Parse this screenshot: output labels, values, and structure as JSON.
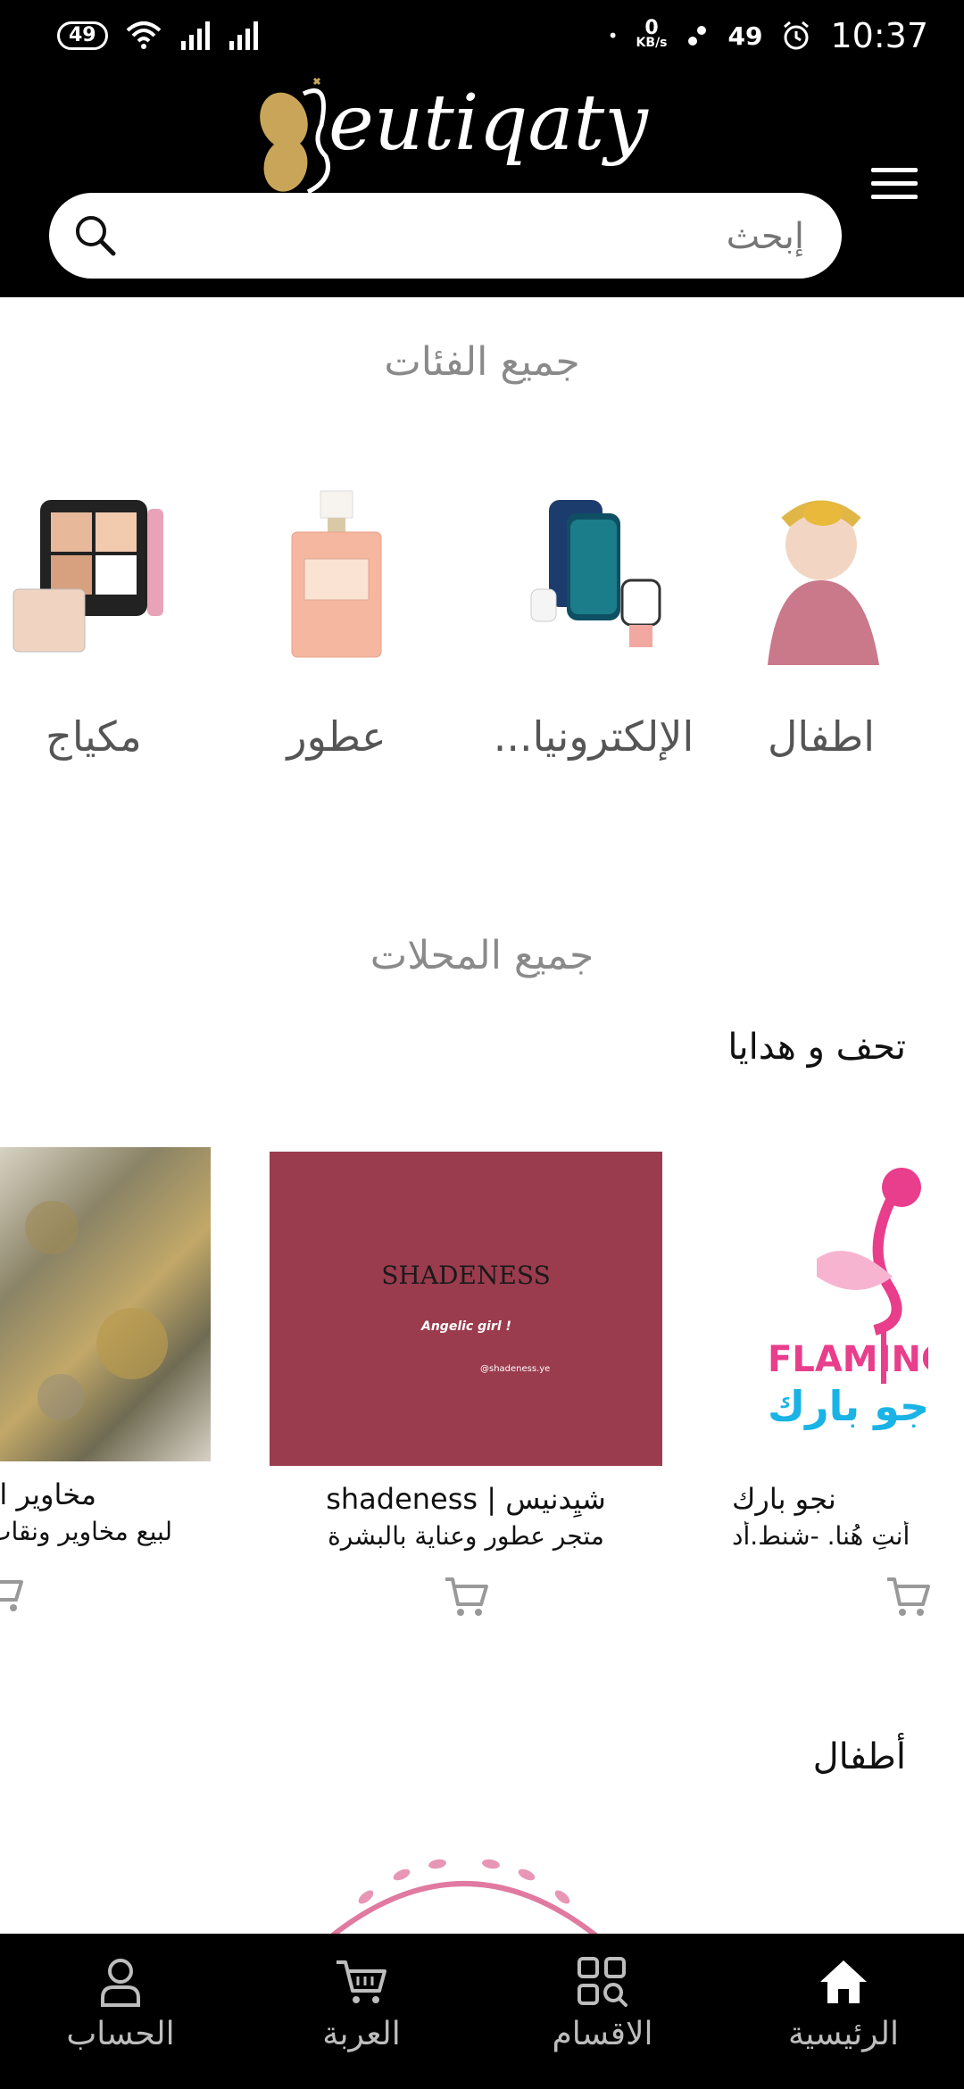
{
  "status_bar": {
    "battery_left": "49",
    "net_speed_value": "0",
    "net_speed_unit": "KB/s",
    "battery_right": "49",
    "time": "10:37"
  },
  "header": {
    "logo_text": "eutiqaty",
    "search_placeholder": "إبحث"
  },
  "categories": {
    "title": "جميع الفئات",
    "items": [
      {
        "label": "اطفال",
        "icon": "kid-photo"
      },
      {
        "label": "الإلكترونيا...",
        "icon": "electronics-photo"
      },
      {
        "label": "عطور",
        "icon": "perfume-photo"
      },
      {
        "label": "مكياج",
        "icon": "makeup-photo"
      }
    ]
  },
  "stores": {
    "title": "جميع المحلات",
    "groups": [
      {
        "title": "تحف و هدايا",
        "items": [
          {
            "name": "نجو بارك",
            "desc": "أنتِ هُنا. -شنط.أد",
            "image_text_1": "FLAMINGO",
            "image_text_2": "جو بارك"
          },
          {
            "name": "شيِدنيس | shadeness",
            "desc": "متجر عطور وعناية بالبشرة",
            "image_text_1": "SHADENESS",
            "image_text_2": "Angelic girl !",
            "image_text_3": "@shadeness.ye"
          },
          {
            "name": "مخاوير ا",
            "desc": "لبيع مخاوير ونقاب"
          }
        ]
      },
      {
        "title": "أطفال"
      }
    ]
  },
  "bottom_nav": {
    "items": [
      {
        "label": "الرئيسية",
        "icon": "home-icon"
      },
      {
        "label": "الاقسام",
        "icon": "categories-icon"
      },
      {
        "label": "العربة",
        "icon": "cart-icon"
      },
      {
        "label": "الحساب",
        "icon": "account-icon"
      }
    ]
  },
  "colors": {
    "header_bg": "#000000",
    "accent_gold": "#c9a55a",
    "shadeness_bg": "#9b3b4e",
    "flamingo_pink": "#e83e8c",
    "flamingo_blue": "#1ab3e6"
  }
}
